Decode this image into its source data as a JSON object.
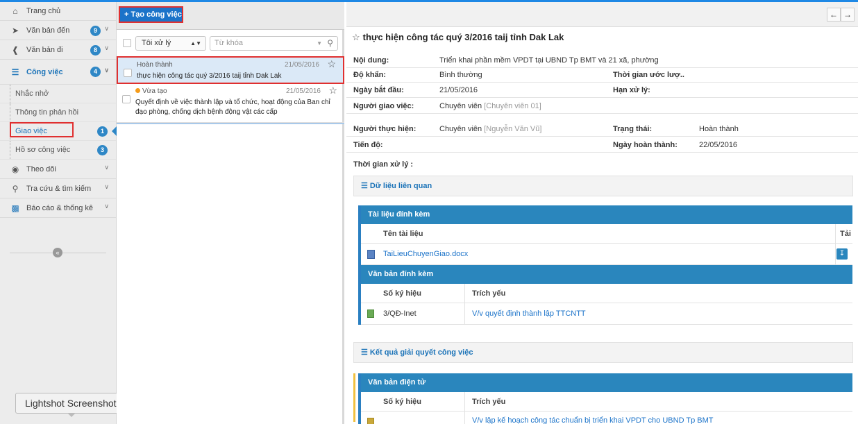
{
  "sidebar": {
    "home": "Trang chủ",
    "items": [
      {
        "label": "Văn bản đến",
        "badge": "9"
      },
      {
        "label": "Văn bản đi",
        "badge": "8"
      },
      {
        "label": "Công việc",
        "badge": "4"
      }
    ],
    "sub_items": [
      {
        "label": "Nhắc nhở"
      },
      {
        "label": "Thông tin phản hồi"
      },
      {
        "label": "Giao việc",
        "badge": "1"
      },
      {
        "label": "Hồ sơ công việc",
        "badge": "3"
      }
    ],
    "more": [
      {
        "label": "Theo dõi"
      },
      {
        "label": "Tra cứu & tìm kiếm"
      },
      {
        "label": "Báo cáo & thống kê"
      }
    ],
    "collapse_glyph": "«",
    "tooltip": "Lightshot Screenshot"
  },
  "list": {
    "create_label": "+ Tạo công việc",
    "filter_value": "Tôi xử lý",
    "search_placeholder": "Từ khóa",
    "tasks": [
      {
        "status": "Hoàn thành",
        "date": "21/05/2016",
        "title": "thực hiện công tác quý 3/2016 taij tỉnh Dak Lak"
      },
      {
        "status": "Vừa tạo",
        "date": "21/05/2016",
        "title": "Quyết định về việc thành lập và tổ chức, hoạt động của Ban chỉ đạo phòng, chống dịch bệnh động vật các cấp"
      }
    ]
  },
  "detail": {
    "title": "thực hiện công tác quý 3/2016 taij tỉnh Dak Lak",
    "rows": {
      "noi_dung": {
        "label": "Nội dung:",
        "value": "Triển khai phần mềm VPDT tại UBND Tp BMT và 21 xã, phường"
      },
      "do_khan": {
        "label": "Độ khẩn:",
        "value": "Bình thường",
        "label2": "Thời gian ước lượ.."
      },
      "ngay_bat_dau": {
        "label": "Ngày bắt đầu:",
        "value": "21/05/2016",
        "label2": "Hạn xử lý:"
      },
      "nguoi_giao": {
        "label": "Người giao việc:",
        "value": "Chuyên viên",
        "value_extra": "[Chuyên viên 01]"
      },
      "nguoi_thuc_hien": {
        "label": "Người thực hiện:",
        "value": "Chuyên viên",
        "value_extra": "[Nguyễn Văn Vũ]",
        "label2": "Trạng thái:",
        "value2": "Hoàn thành"
      },
      "tien_do": {
        "label": "Tiến độ:",
        "label2": "Ngày hoàn thành:",
        "value2": "22/05/2016"
      },
      "thoi_gian": {
        "label": "Thời gian xử lý :"
      }
    },
    "related": {
      "heading": "Dữ liệu liên quan",
      "attach_header": "Tài liệu đính kèm",
      "attach_col": "Tên tài liệu",
      "attach_col_right": "Tải",
      "attach_file": "TaiLieuChuyenGiao.docx",
      "doc_header": "Văn bản đính kèm",
      "col_so": "Số ký hiệu",
      "col_trich": "Trích yếu",
      "doc_so": "3/QĐ-Inet",
      "doc_trich": "V/v quyết định thành lập TTCNTT"
    },
    "result": {
      "heading": "Kết quả giải quyết công việc",
      "e_header": "Văn bản điện tử",
      "col_so": "Số ký hiệu",
      "col_trich": "Trích yếu",
      "partial_trich": "V/v lập kế hoạch công tác chuẩn bị triển khai VPDT cho UBND Tp BMT"
    }
  }
}
